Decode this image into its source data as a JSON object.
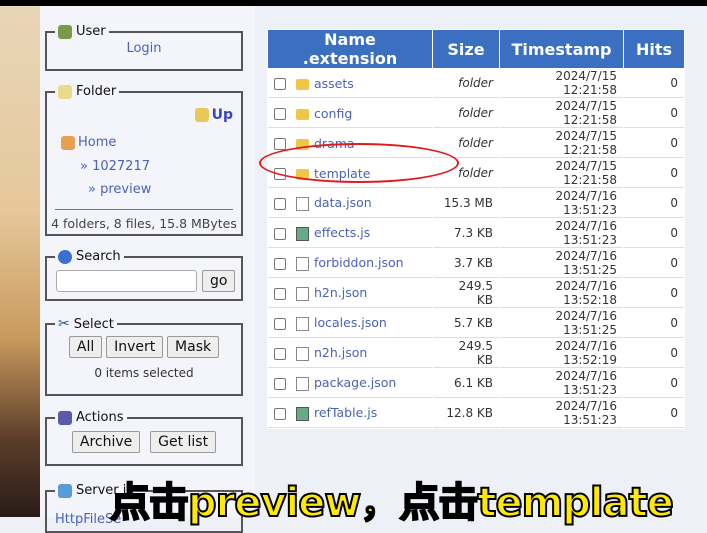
{
  "sidebar": {
    "user": {
      "legend": "User",
      "login": "Login"
    },
    "folder": {
      "legend": "Folder",
      "up": "Up",
      "home": "Home",
      "crumbs": [
        "» 1027217",
        "» preview"
      ],
      "summary": "4 folders, 8 files, 15.8 MBytes"
    },
    "search": {
      "legend": "Search",
      "value": "",
      "go": "go"
    },
    "select": {
      "legend": "Select",
      "all": "All",
      "invert": "Invert",
      "mask": "Mask",
      "status": "0 items selected"
    },
    "actions": {
      "legend": "Actions",
      "archive": "Archive",
      "getlist": "Get list"
    },
    "server": {
      "legend": "Server i",
      "link": "HttpFileSe"
    }
  },
  "table": {
    "headers": [
      "Name .extension",
      "Size",
      "Timestamp",
      "Hits"
    ],
    "rows": [
      {
        "name": "assets",
        "icon": "folder",
        "size": "folder",
        "ts": "2024/7/15 12:21:58",
        "hits": "0"
      },
      {
        "name": "config",
        "icon": "folder",
        "size": "folder",
        "ts": "2024/7/15 12:21:58",
        "hits": "0"
      },
      {
        "name": "drama",
        "icon": "folder",
        "size": "folder",
        "ts": "2024/7/15 12:21:58",
        "hits": "0"
      },
      {
        "name": "template",
        "icon": "folder",
        "size": "folder",
        "ts": "2024/7/15 12:21:58",
        "hits": "0"
      },
      {
        "name": "data.json",
        "icon": "file",
        "size": "15.3 MB",
        "ts": "2024/7/16 13:51:23",
        "hits": "0"
      },
      {
        "name": "effects.js",
        "icon": "script",
        "size": "7.3 KB",
        "ts": "2024/7/16 13:51:23",
        "hits": "0"
      },
      {
        "name": "forbiddon.json",
        "icon": "file",
        "size": "3.7 KB",
        "ts": "2024/7/16 13:51:25",
        "hits": "0"
      },
      {
        "name": "h2n.json",
        "icon": "file",
        "size": "249.5 KB",
        "ts": "2024/7/16 13:52:18",
        "hits": "0"
      },
      {
        "name": "locales.json",
        "icon": "file",
        "size": "5.7 KB",
        "ts": "2024/7/16 13:51:25",
        "hits": "0"
      },
      {
        "name": "n2h.json",
        "icon": "file",
        "size": "249.5 KB",
        "ts": "2024/7/16 13:52:19",
        "hits": "0"
      },
      {
        "name": "package.json",
        "icon": "file",
        "size": "6.1 KB",
        "ts": "2024/7/16 13:51:23",
        "hits": "0"
      },
      {
        "name": "refTable.js",
        "icon": "script",
        "size": "12.8 KB",
        "ts": "2024/7/16 13:51:23",
        "hits": "0"
      }
    ]
  },
  "caption": "点击preview，点击template",
  "colors": {
    "header": "#3b6fc2",
    "link": "#4a63b5",
    "highlight": "#e01b1b",
    "caption": "#ffe900"
  }
}
